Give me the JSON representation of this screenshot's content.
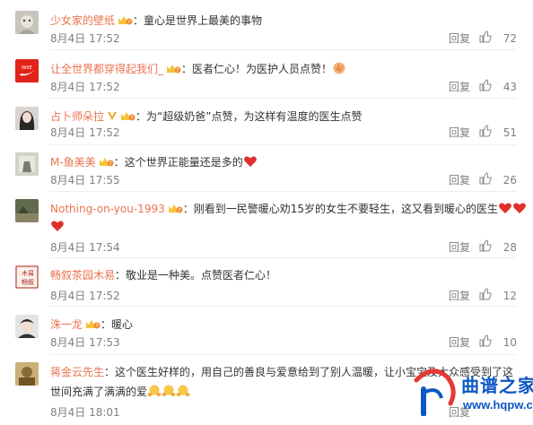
{
  "comments": [
    {
      "user": "少女家的壁纸",
      "sep": "：",
      "text": "童心是世界上最美的事物",
      "time": "8月4日 17:52",
      "reply": "回复",
      "likes": "72"
    },
    {
      "user": "让全世界都穿得起我们_",
      "sep": "：",
      "text": "医者仁心！为医护人员点赞！",
      "time": "8月4日 17:52",
      "reply": "回复",
      "likes": "43",
      "avatar_text": "NIKE"
    },
    {
      "user": "占卜师朵拉",
      "sep": "：",
      "text": "为“超级奶爸”点赞，为这样有温度的医生点赞",
      "time": "8月4日 17:52",
      "reply": "回复",
      "likes": "51"
    },
    {
      "user": "M-鱼美美",
      "sep": "：",
      "text": "这个世界正能量还是多的",
      "time": "8月4日 17:55",
      "reply": "回复",
      "likes": "26"
    },
    {
      "user": "Nothing-on-you-1993",
      "sep": "：",
      "text": "刚看到一民警暖心劝15岁的女生不要轻生，这又看到暖心的医生",
      "time": "8月4日 17:54",
      "reply": "回复",
      "likes": "28"
    },
    {
      "user": "畅叙茶园木易",
      "sep": "：",
      "text": "敬业是一种美。点赞医者仁心！",
      "time": "8月4日 17:52",
      "reply": "回复",
      "likes": "12",
      "avatar_text": "木易"
    },
    {
      "user": "洙一龙",
      "sep": "：",
      "text": "暖心",
      "time": "8月4日 17:53",
      "reply": "回复",
      "likes": "10"
    },
    {
      "user": "蒋金云先生",
      "sep": "：",
      "text": "这个医生好样的，用自己的善良与爱意给到了别人温暖，让小宝宝及大众感受到了这",
      "text2": "世间充满了满满的爱",
      "time": "8月4日 18:01",
      "reply": "回复"
    }
  ],
  "watermark": {
    "name": "曲谱之家",
    "url": "www.hqpw.com"
  },
  "colors": {
    "username": "#eb7350",
    "meta": "#808080",
    "heart": "#e0302b",
    "watermark": "#0d57c4"
  },
  "icons": [
    "vip-crown-badge",
    "heart-emoji",
    "thumb-up-icon",
    "hug-emoji",
    "clap-emoji"
  ]
}
